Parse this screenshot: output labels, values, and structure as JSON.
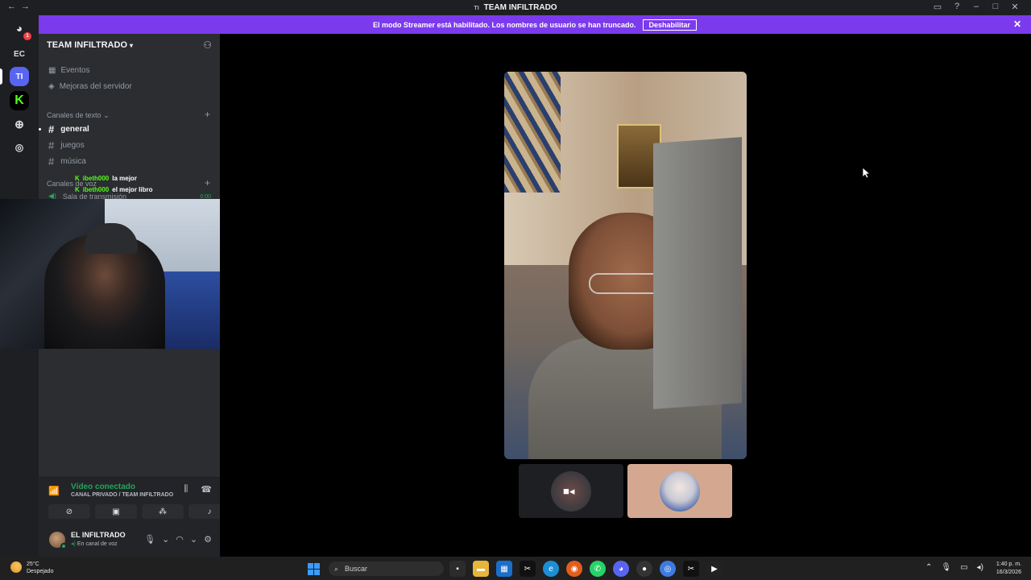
{
  "window": {
    "title": "TEAM INFILTRADO",
    "title_icon": "TI"
  },
  "banner": {
    "message": "El modo Streamer está habilitado. Los nombres de usuario se han truncado.",
    "button": "Deshabilitar"
  },
  "rail": {
    "home_badge": "1",
    "servers": [
      "EC",
      "TI"
    ]
  },
  "sidebar": {
    "server_name": "TEAM INFILTRADO",
    "nav": [
      {
        "label": "Eventos",
        "icon": "calendar-icon"
      },
      {
        "label": "Mejoras del servidor",
        "icon": "boost-icon"
      }
    ],
    "text_category": "Canales de texto",
    "text_channels": [
      "general",
      "juegos",
      "música"
    ],
    "voice_category": "Canales de voz",
    "voice_channel": "Sala de transmisión",
    "voice_time": "0:00"
  },
  "chat_overlay": [
    {
      "user": "ibeth000",
      "message": "la mejor"
    },
    {
      "user": "ibeth000",
      "message": "el mejor libro"
    }
  ],
  "voice_panel": {
    "status": "Vídeo conectado",
    "location": "CANAL PRIVADO / TEAM INFILTRADO"
  },
  "user": {
    "name": "EL INFILTRADO",
    "status": "En canal de voz"
  },
  "taskbar": {
    "temperature": "25°C",
    "condition": "Despejado",
    "search_placeholder": "Buscar",
    "time": "1:40 p. m.",
    "date": "16/3/2026"
  },
  "colors": {
    "banner": "#7c3aed",
    "accent": "#5865f2",
    "connected": "#23a55a",
    "kick_green": "#53fc18"
  }
}
